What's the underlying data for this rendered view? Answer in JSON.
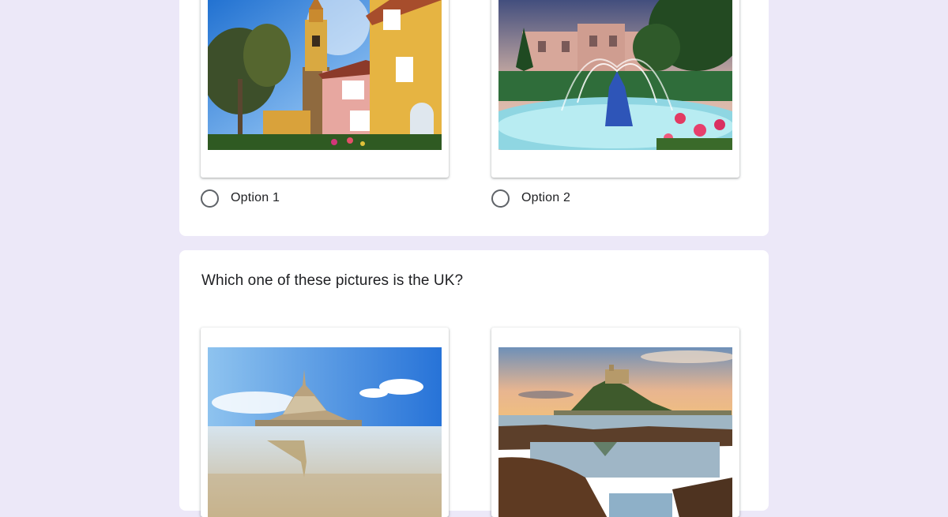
{
  "questions": [
    {
      "title": "",
      "options": [
        {
          "label": "Option 1",
          "image": "portmeirion-village-photo",
          "selected": false
        },
        {
          "label": "Option 2",
          "image": "portmeirion-fountain-photo",
          "selected": false
        }
      ]
    },
    {
      "title": "Which one of these pictures is the UK?",
      "options": [
        {
          "image": "mont-saint-michel-photo"
        },
        {
          "image": "st-michaels-mount-photo"
        }
      ]
    }
  ],
  "colors": {
    "page_background": "#ece8f8",
    "card_background": "#ffffff",
    "radio_border": "#5f6368",
    "text": "#202124"
  }
}
